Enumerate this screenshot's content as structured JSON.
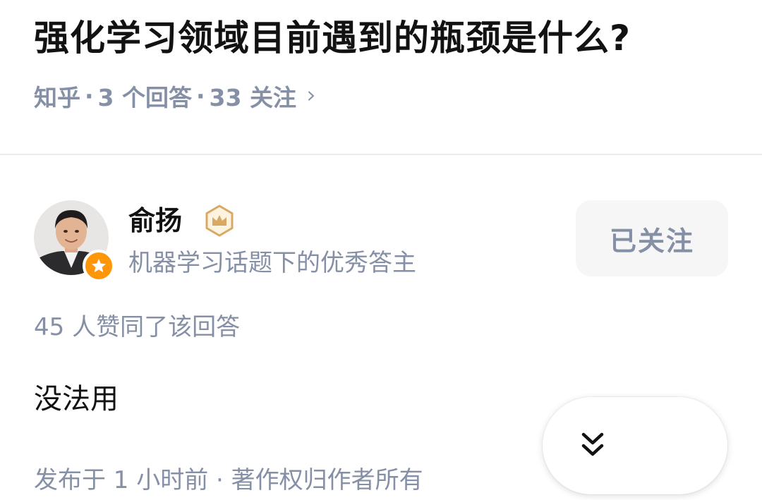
{
  "question": {
    "title": "强化学习领域目前遇到的瓶颈是什么?",
    "source": "知乎",
    "answers_count": "3 个回答",
    "followers_count": "33 关注",
    "separator": "·"
  },
  "author": {
    "name": "俞扬",
    "description": "机器学习话题下的优秀答主",
    "follow_label": "已关注",
    "avatar_badge_icon": "star-icon",
    "verified_badge_icon": "crown-icon"
  },
  "answer": {
    "votes_text": "45 人赞同了该回答",
    "body": "没法用",
    "timestamp": "发布于 1 小时前 · 著作权归作者所有"
  },
  "floating": {
    "icon": "double-chevron-down-icon"
  },
  "colors": {
    "text_primary": "#121212",
    "text_secondary": "#8590a6",
    "badge_orange": "#ff9607",
    "crown_gold": "#d9a862",
    "divider": "#ececec",
    "button_bg": "#f6f6f6"
  }
}
